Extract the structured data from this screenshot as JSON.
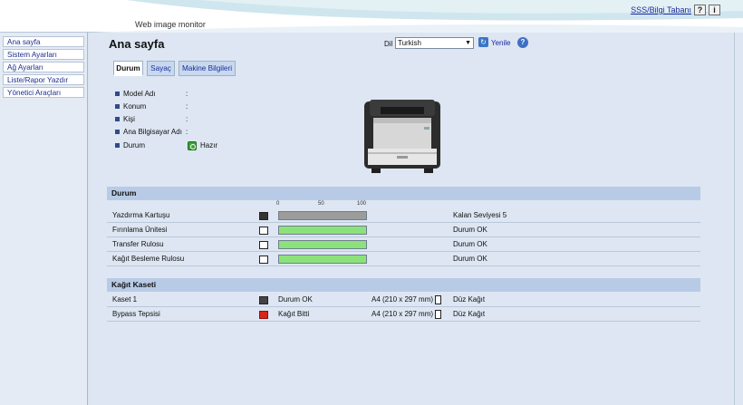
{
  "header": {
    "app_title": "Web image monitor",
    "faq_link": "SSS/Bilgi Tabanı",
    "help_button": "?",
    "info_button": "i"
  },
  "sidebar": {
    "items": [
      {
        "label": "Ana sayfa"
      },
      {
        "label": "Sistem Ayarları"
      },
      {
        "label": "Ağ Ayarları"
      },
      {
        "label": "Liste/Rapor Yazdır"
      },
      {
        "label": "Yönetici Araçları"
      }
    ]
  },
  "main": {
    "title": "Ana sayfa",
    "language_label": "Dil",
    "language_value": "Turkish",
    "refresh_label": "Yenile",
    "tabs": [
      {
        "label": "Durum",
        "active": true
      },
      {
        "label": "Sayaç",
        "active": false
      },
      {
        "label": "Makine Bilgileri",
        "active": false
      }
    ],
    "info": [
      {
        "label": "Model Adı",
        "value": ""
      },
      {
        "label": "Konum",
        "value": ""
      },
      {
        "label": "Kişi",
        "value": ""
      },
      {
        "label": "Ana Bilgisayar Adı",
        "value": ""
      },
      {
        "label": "Durum",
        "value": "Hazır"
      }
    ]
  },
  "status_section": {
    "title": "Durum",
    "scale": [
      "0",
      "50",
      "100"
    ],
    "rows": [
      {
        "name": "Yazdırma Kartuşu",
        "level": 100,
        "bar_color": "#9c9c9c",
        "status": "Kalan Seviyesi 5"
      },
      {
        "name": "Fırınlama Ünitesi",
        "level": 100,
        "bar_color": "#8be27a",
        "status": "Durum OK"
      },
      {
        "name": "Transfer Rulosu",
        "level": 100,
        "bar_color": "#8be27a",
        "status": "Durum OK"
      },
      {
        "name": "Kağıt Besleme Rulosu",
        "level": 100,
        "bar_color": "#8be27a",
        "status": "Durum OK"
      }
    ]
  },
  "tray_section": {
    "title": "Kağıt Kaseti",
    "rows": [
      {
        "name": "Kaset 1",
        "status": "Durum OK",
        "size": "A4 (210 x 297 mm)",
        "type": "Düz Kağıt",
        "error": false
      },
      {
        "name": "Bypass Tepsisi",
        "status": "Kağıt Bitti",
        "size": "A4 (210 x 297 mm)",
        "type": "Düz Kağıt",
        "error": true
      }
    ]
  },
  "colors": {
    "accent": "#1a2a9c",
    "section_bar": "#b8cbe6",
    "ok_green": "#3aa335",
    "error_red": "#d9241b"
  }
}
